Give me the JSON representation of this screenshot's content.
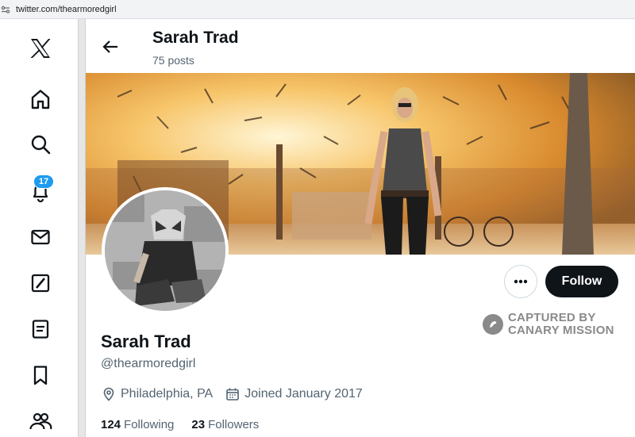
{
  "browser": {
    "url": "twitter.com/thearmoredgirl"
  },
  "nav": {
    "items": [
      {
        "name": "x-logo-icon"
      },
      {
        "name": "home-icon"
      },
      {
        "name": "search-icon"
      },
      {
        "name": "notifications-icon"
      },
      {
        "name": "messages-icon"
      },
      {
        "name": "grok-icon"
      },
      {
        "name": "lists-icon"
      },
      {
        "name": "bookmarks-icon"
      },
      {
        "name": "communities-icon"
      }
    ],
    "notification_count": "17"
  },
  "header": {
    "name": "Sarah Trad",
    "posts": "75 posts"
  },
  "profile": {
    "display_name": "Sarah Trad",
    "handle": "@thearmoredgirl",
    "location": "Philadelphia, PA",
    "joined": "Joined January 2017",
    "following_count": "124",
    "following_label": "Following",
    "followers_count": "23",
    "followers_label": "Followers",
    "follow_label": "Follow",
    "more_label": "•••"
  },
  "watermark": {
    "line1": "CAPTURED BY",
    "line2": "CANARY MISSION"
  },
  "colors": {
    "accent": "#1d9bf0",
    "text": "#0f1419",
    "secondary": "#536471"
  }
}
